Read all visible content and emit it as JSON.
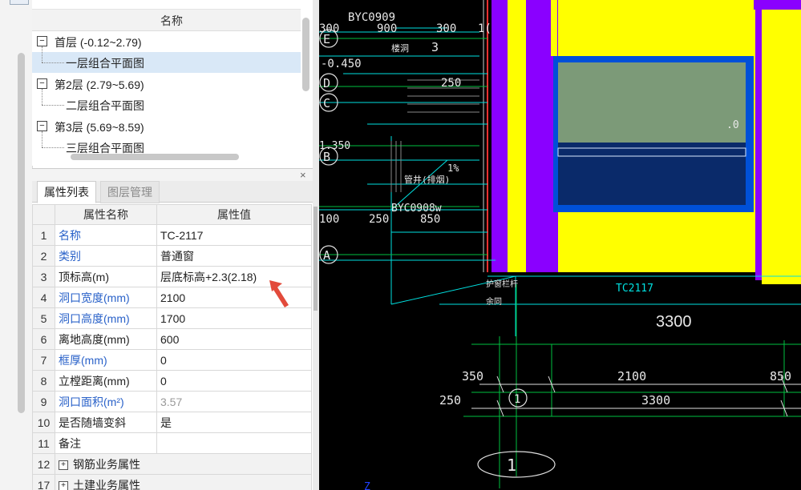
{
  "tree": {
    "header": "名称",
    "items": [
      {
        "label": "首层 (-0.12~2.79)",
        "expander": "−"
      },
      {
        "label": "一层组合平面图"
      },
      {
        "label": "第2层 (2.79~5.69)",
        "expander": "−"
      },
      {
        "label": "二层组合平面图"
      },
      {
        "label": "第3层 (5.69~8.59)",
        "expander": "−"
      },
      {
        "label": "三层组合平面图"
      }
    ]
  },
  "prop_panel": {
    "close": "×",
    "tabs": [
      "属性列表",
      "图层管理"
    ],
    "columns": [
      "属性名称",
      "属性值"
    ],
    "rows": [
      {
        "num": "1",
        "name": "名称",
        "value": "TC-2117"
      },
      {
        "num": "2",
        "name": "类别",
        "value": "普通窗"
      },
      {
        "num": "3",
        "name": "顶标高(m)",
        "value": "层底标高+2.3(2.18)"
      },
      {
        "num": "4",
        "name": "洞口宽度(mm)",
        "value": "2100"
      },
      {
        "num": "5",
        "name": "洞口高度(mm)",
        "value": "1700"
      },
      {
        "num": "6",
        "name": "离地高度(mm)",
        "value": "600"
      },
      {
        "num": "7",
        "name": "框厚(mm)",
        "value": "0"
      },
      {
        "num": "8",
        "name": "立樘距离(mm)",
        "value": "0"
      },
      {
        "num": "9",
        "name": "洞口面积(m²)",
        "value": "3.57"
      },
      {
        "num": "10",
        "name": "是否随墙变斜",
        "value": "是"
      },
      {
        "num": "11",
        "name": "备注",
        "value": ""
      },
      {
        "num": "12",
        "name": "钢筋业务属性",
        "value": "",
        "expander": "+"
      },
      {
        "num": "17",
        "name": "土建业务属性",
        "value": "",
        "expander": "+"
      }
    ]
  },
  "cad": {
    "labels": {
      "byc0909": "BYC0909",
      "dims_top": [
        "300",
        "900",
        "300",
        "1("
      ],
      "axis_e": "E",
      "axis_d": "D",
      "axis_c": "C",
      "axis_b": "B",
      "axis_a": "A",
      "axis_1": "1",
      "lvl_neg0450": "-0.450",
      "lvl_1350": "1.350",
      "lvl_0": ".0",
      "dong3": "3",
      "dong_label": "楼洞",
      "dim_250_top": "250",
      "pct": "1%",
      "pipe": "管井(排烟)",
      "byc0908": "BYC0908w",
      "dims_bottom": [
        "100",
        "250",
        "850"
      ],
      "guardrail": "护窗栏杆",
      "yugu": "余同",
      "window_tag": "TC2117",
      "dim_3300_big": "3300",
      "dim_350": "350",
      "dim_2100": "2100",
      "dim_850": "850",
      "dim_250": "250",
      "dim_3300": "3300",
      "z_mark": "Z"
    }
  },
  "colors": {
    "cad_bg": "#000000",
    "wall_yellow": "#ffff00",
    "column_purple": "#8a00ff",
    "window_blue": "#0050d8",
    "selected_row": "#d9e8f7",
    "link_blue": "#2a62c9",
    "pointer_red": "#e24a3b",
    "cad_cyan": "#00e0e0",
    "cad_green": "#00c040"
  }
}
